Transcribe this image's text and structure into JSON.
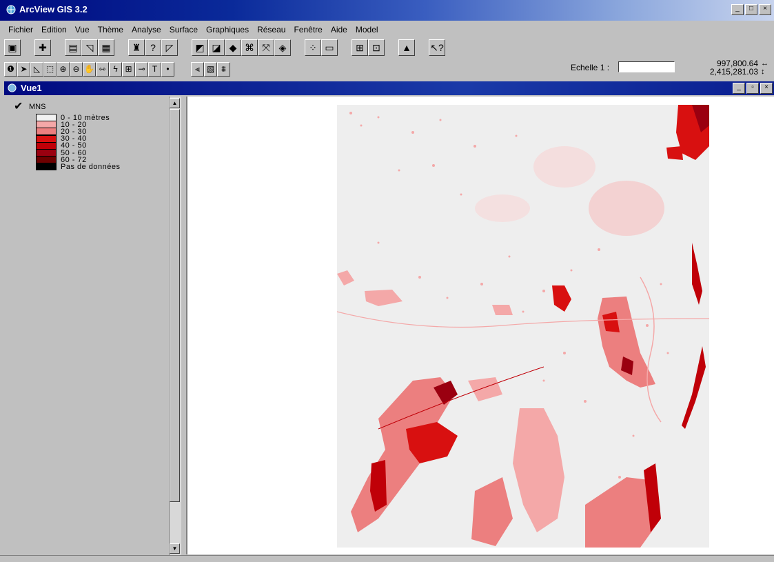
{
  "window": {
    "title": "ArcView GIS 3.2",
    "buttons": [
      "_",
      "□",
      "×"
    ]
  },
  "menu": [
    "Fichier",
    "Edition",
    "Vue",
    "Thème",
    "Analyse",
    "Surface",
    "Graphiques",
    "Réseau",
    "Fenêtre",
    "Aide",
    "Model"
  ],
  "toolbar1": [
    "save-icon",
    "add-theme-icon",
    "theme-properties-icon",
    "edit-legend-icon",
    "open-table-icon",
    "find-icon",
    "query-builder-icon",
    "locate-icon",
    "select-by-theme-icon",
    "clear-selection-icon",
    "zoom-full-icon",
    "zoom-active-icon",
    "zoom-selected-icon",
    "zoom-in-fixed-icon",
    "zoom-out-fixed-icon",
    "previous-extent-icon",
    "create-layout-icon",
    "map-calculator-icon",
    "histogram-icon",
    "raster-chart-icon",
    "help-icon"
  ],
  "toolbar2": [
    "identify-icon",
    "pointer-icon",
    "vertex-edit-icon",
    "select-feature-icon",
    "zoom-in-icon",
    "zoom-out-icon",
    "pan-icon",
    "measure-icon",
    "hotlink-icon",
    "area-of-interest-icon",
    "label-icon",
    "text-icon",
    "draw-point-icon",
    "contour-icon",
    "hillshade-icon",
    "profile-icon"
  ],
  "scale": {
    "label": "Echelle 1 :",
    "value": ""
  },
  "coords": {
    "x": "997,800.64",
    "y": "2,415,281.03"
  },
  "view": {
    "title": "Vue1",
    "buttons": [
      "_",
      "▫",
      "×"
    ]
  },
  "legend": {
    "theme": "MNS",
    "checked": true,
    "classes": [
      {
        "label": "0 - 10 mètres",
        "color": "#f2f2f2"
      },
      {
        "label": "10 - 20",
        "color": "#f4a8a8"
      },
      {
        "label": "20 - 30",
        "color": "#ec7f7f"
      },
      {
        "label": "30 - 40",
        "color": "#d81010"
      },
      {
        "label": "40 - 50",
        "color": "#c00008"
      },
      {
        "label": "50 - 60",
        "color": "#9a0010"
      },
      {
        "label": "60 - 72",
        "color": "#6e0000"
      },
      {
        "label": "Pas de données",
        "color": "#000000"
      }
    ]
  },
  "colors": {
    "titlebar": "#000a80",
    "map_background": "#eeeeee",
    "highlight": "#ec7f7f"
  }
}
